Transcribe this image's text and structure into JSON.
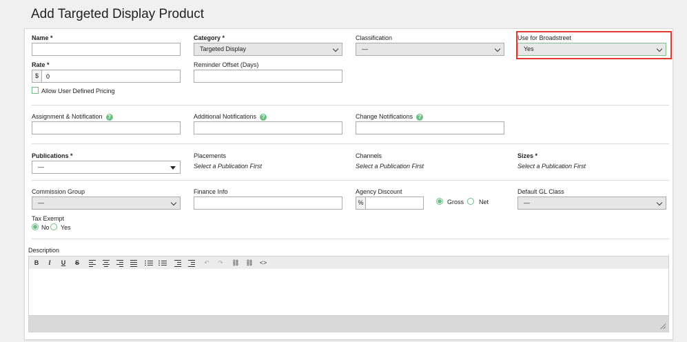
{
  "page": {
    "title": "Add Targeted Display Product"
  },
  "colors": {
    "accent_green": "#6dbf83",
    "highlight_red": "#e03a2f"
  },
  "fields": {
    "name": {
      "label": "Name *",
      "value": ""
    },
    "category": {
      "label": "Category *",
      "value": "Targeted Display"
    },
    "classification": {
      "label": "Classification",
      "value": "—"
    },
    "use_for_broadstreet": {
      "label": "Use for Broadstreet",
      "value": "Yes"
    },
    "rate": {
      "label": "Rate *",
      "prefix": "$",
      "value": "0"
    },
    "reminder_offset": {
      "label": "Reminder Offset (Days)",
      "value": ""
    },
    "allow_user_pricing": {
      "label": "Allow User Defined Pricing"
    },
    "assignment_notification": {
      "label": "Assignment & Notification",
      "value": ""
    },
    "additional_notifications": {
      "label": "Additional Notifications",
      "value": ""
    },
    "change_notifications": {
      "label": "Change Notifications",
      "value": ""
    },
    "publications": {
      "label": "Publications *",
      "value": "—"
    },
    "placements": {
      "label": "Placements",
      "hint": "Select a Publication First"
    },
    "channels": {
      "label": "Channels",
      "hint": "Select a Publication First"
    },
    "sizes": {
      "label": "Sizes *",
      "hint": "Select a Publication First"
    },
    "commission_group": {
      "label": "Commission Group",
      "value": "—"
    },
    "finance_info": {
      "label": "Finance Info",
      "value": ""
    },
    "agency_discount": {
      "label": "Agency Discount",
      "prefix": "%",
      "value": "",
      "gross": "Gross",
      "net": "Net"
    },
    "default_gl_class": {
      "label": "Default GL Class",
      "value": "—"
    },
    "tax_exempt": {
      "label": "Tax Exempt",
      "no": "No",
      "yes": "Yes"
    },
    "description": {
      "label": "Description"
    }
  },
  "help_glyph": "?",
  "toolbar": {
    "bold": "B",
    "italic": "I",
    "underline": "U",
    "strike": "S",
    "code": "<>"
  }
}
